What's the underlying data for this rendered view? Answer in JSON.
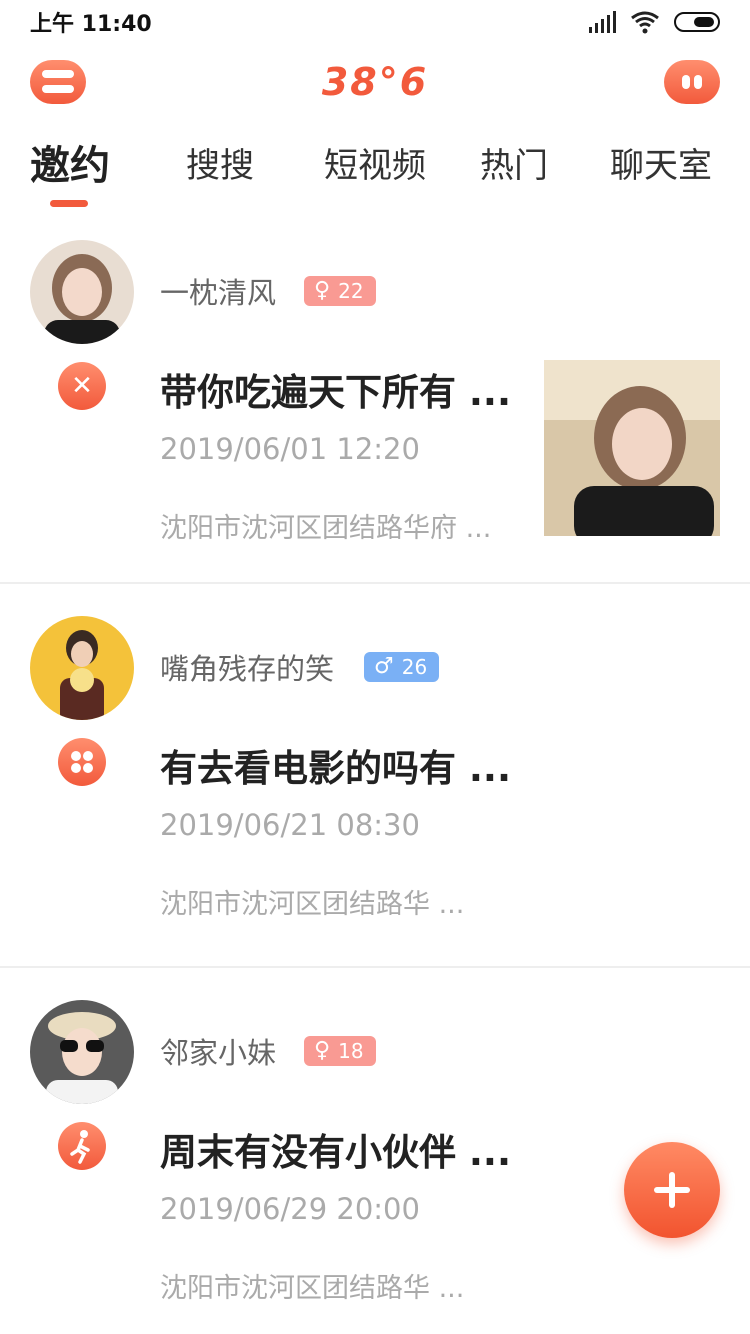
{
  "status_bar": {
    "time": "上午 11:40",
    "icons": [
      "signal-icon",
      "wifi-icon",
      "battery-icon"
    ]
  },
  "header": {
    "logo_text": "38°6",
    "left_icon": "menu-icon",
    "right_icon": "chat-bot-icon",
    "accent_color": "#f25a3c"
  },
  "tabs": [
    {
      "label": "邀约",
      "active": true
    },
    {
      "label": "搜搜",
      "active": false
    },
    {
      "label": "短视频",
      "active": false
    },
    {
      "label": "热门",
      "active": false
    },
    {
      "label": "聊天室",
      "active": false
    }
  ],
  "feed": [
    {
      "username": "一枕清风",
      "gender": "female",
      "gender_symbol": "♀",
      "age": "22",
      "category_icon": "dining-icon",
      "title": "带你吃遍天下所有 ...",
      "datetime": "2019/06/01 12:20",
      "address": "沈阳市沈河区团结路华府 ...",
      "has_thumbnail": true
    },
    {
      "username": "嘴角残存的笑",
      "gender": "male",
      "gender_symbol": "♂",
      "age": "26",
      "category_icon": "entertainment-icon",
      "title": "有去看电影的吗有 ...",
      "datetime": "2019/06/21 08:30",
      "address": "沈阳市沈河区团结路华 ...",
      "has_thumbnail": false
    },
    {
      "username": "邻家小妹",
      "gender": "female",
      "gender_symbol": "♀",
      "age": "18",
      "category_icon": "sport-icon",
      "title": "周末有没有小伙伴 ...",
      "datetime": "2019/06/29 20:00",
      "address": "沈阳市沈河区团结路华 ...",
      "has_thumbnail": false
    }
  ],
  "fab": {
    "icon": "plus-icon"
  }
}
